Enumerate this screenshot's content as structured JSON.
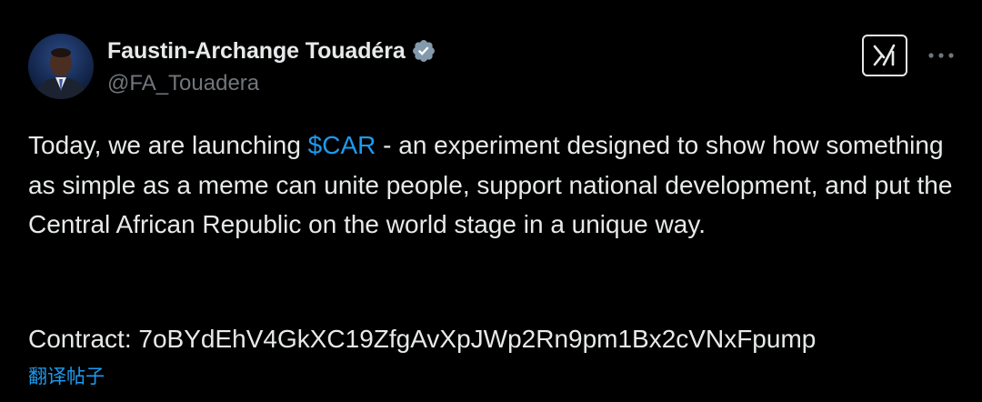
{
  "tweet": {
    "author": {
      "display_name": "Faustin-Archange Touadéra",
      "handle": "@FA_Touadera",
      "verified": true
    },
    "text": {
      "before_cashtag": "Today, we are launching ",
      "cashtag": "$CAR",
      "after_cashtag": " - an experiment designed to show how something as simple as a meme can unite people, support national development, and put the Central African Republic on the world stage in a unique way."
    },
    "contract": {
      "label": "Contract: ",
      "address": "7oBYdEhV4GkXC19ZfgAvXpJWp2Rn9pm1Bx2cVNxFpump"
    },
    "translate_label": "翻译帖子"
  },
  "icons": {
    "verified": "verified-badge-icon",
    "grok": "grok-icon",
    "more": "more-options-icon"
  },
  "colors": {
    "background": "#000000",
    "text_primary": "#e7e9ea",
    "text_secondary": "#71767b",
    "accent": "#1d9bf0"
  }
}
